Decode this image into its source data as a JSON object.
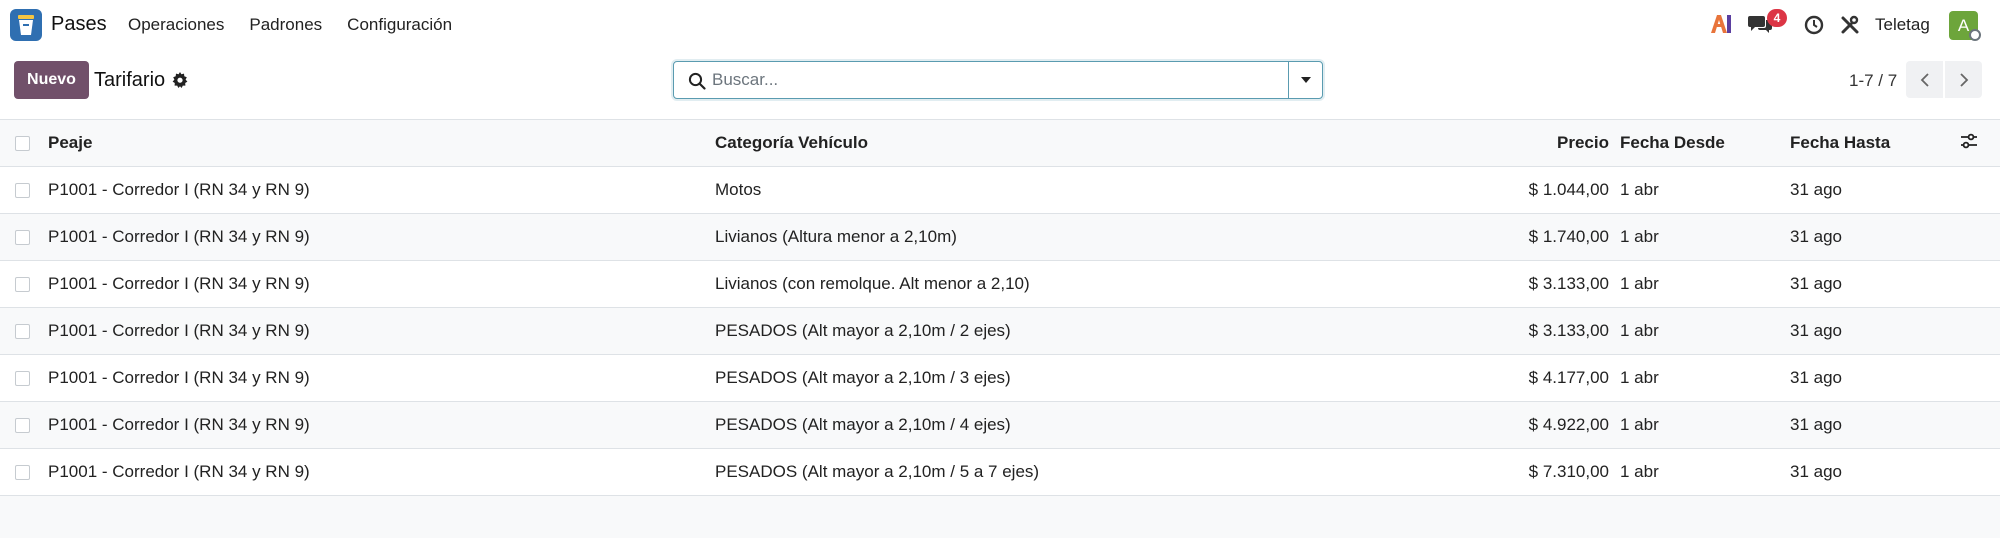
{
  "app": {
    "name": "Pases",
    "menu": [
      "Operaciones",
      "Padrones",
      "Configuración"
    ],
    "brand_color": "#2f6fb1"
  },
  "systray": {
    "ai_label": "AI",
    "chat_badge": "4",
    "company": "Teletag",
    "avatar_letter": "A",
    "icons": [
      "ai-icon",
      "chat-icon",
      "clock-icon",
      "tools-icon"
    ]
  },
  "control_panel": {
    "new_label": "Nuevo",
    "title": "Tarifario",
    "search_placeholder": "Buscar...",
    "pager_value": "1-7 / 7",
    "accent_color": "#71506a"
  },
  "list": {
    "columns": [
      "Peaje",
      "Categoría Vehículo",
      "Precio",
      "Fecha Desde",
      "Fecha Hasta"
    ],
    "rows": [
      {
        "peaje": "P1001 - Corredor I (RN 34 y RN 9)",
        "categoria": "Motos",
        "precio": "$ 1.044,00",
        "desde": "1 abr",
        "hasta": "31 ago"
      },
      {
        "peaje": "P1001 - Corredor I (RN 34 y RN 9)",
        "categoria": "Livianos (Altura menor a 2,10m)",
        "precio": "$ 1.740,00",
        "desde": "1 abr",
        "hasta": "31 ago"
      },
      {
        "peaje": "P1001 - Corredor I (RN 34 y RN 9)",
        "categoria": "Livianos (con remolque. Alt menor a 2,10)",
        "precio": "$ 3.133,00",
        "desde": "1 abr",
        "hasta": "31 ago"
      },
      {
        "peaje": "P1001 - Corredor I (RN 34 y RN 9)",
        "categoria": "PESADOS (Alt mayor a 2,10m / 2 ejes)",
        "precio": "$ 3.133,00",
        "desde": "1 abr",
        "hasta": "31 ago"
      },
      {
        "peaje": "P1001 - Corredor I (RN 34 y RN 9)",
        "categoria": "PESADOS (Alt mayor a 2,10m / 3 ejes)",
        "precio": "$ 4.177,00",
        "desde": "1 abr",
        "hasta": "31 ago"
      },
      {
        "peaje": "P1001 - Corredor I (RN 34 y RN 9)",
        "categoria": "PESADOS (Alt mayor a 2,10m / 4 ejes)",
        "precio": "$ 4.922,00",
        "desde": "1 abr",
        "hasta": "31 ago"
      },
      {
        "peaje": "P1001 - Corredor I (RN 34 y RN 9)",
        "categoria": "PESADOS (Alt mayor a 2,10m / 5 a 7 ejes)",
        "precio": "$ 7.310,00",
        "desde": "1 abr",
        "hasta": "31 ago"
      }
    ]
  }
}
